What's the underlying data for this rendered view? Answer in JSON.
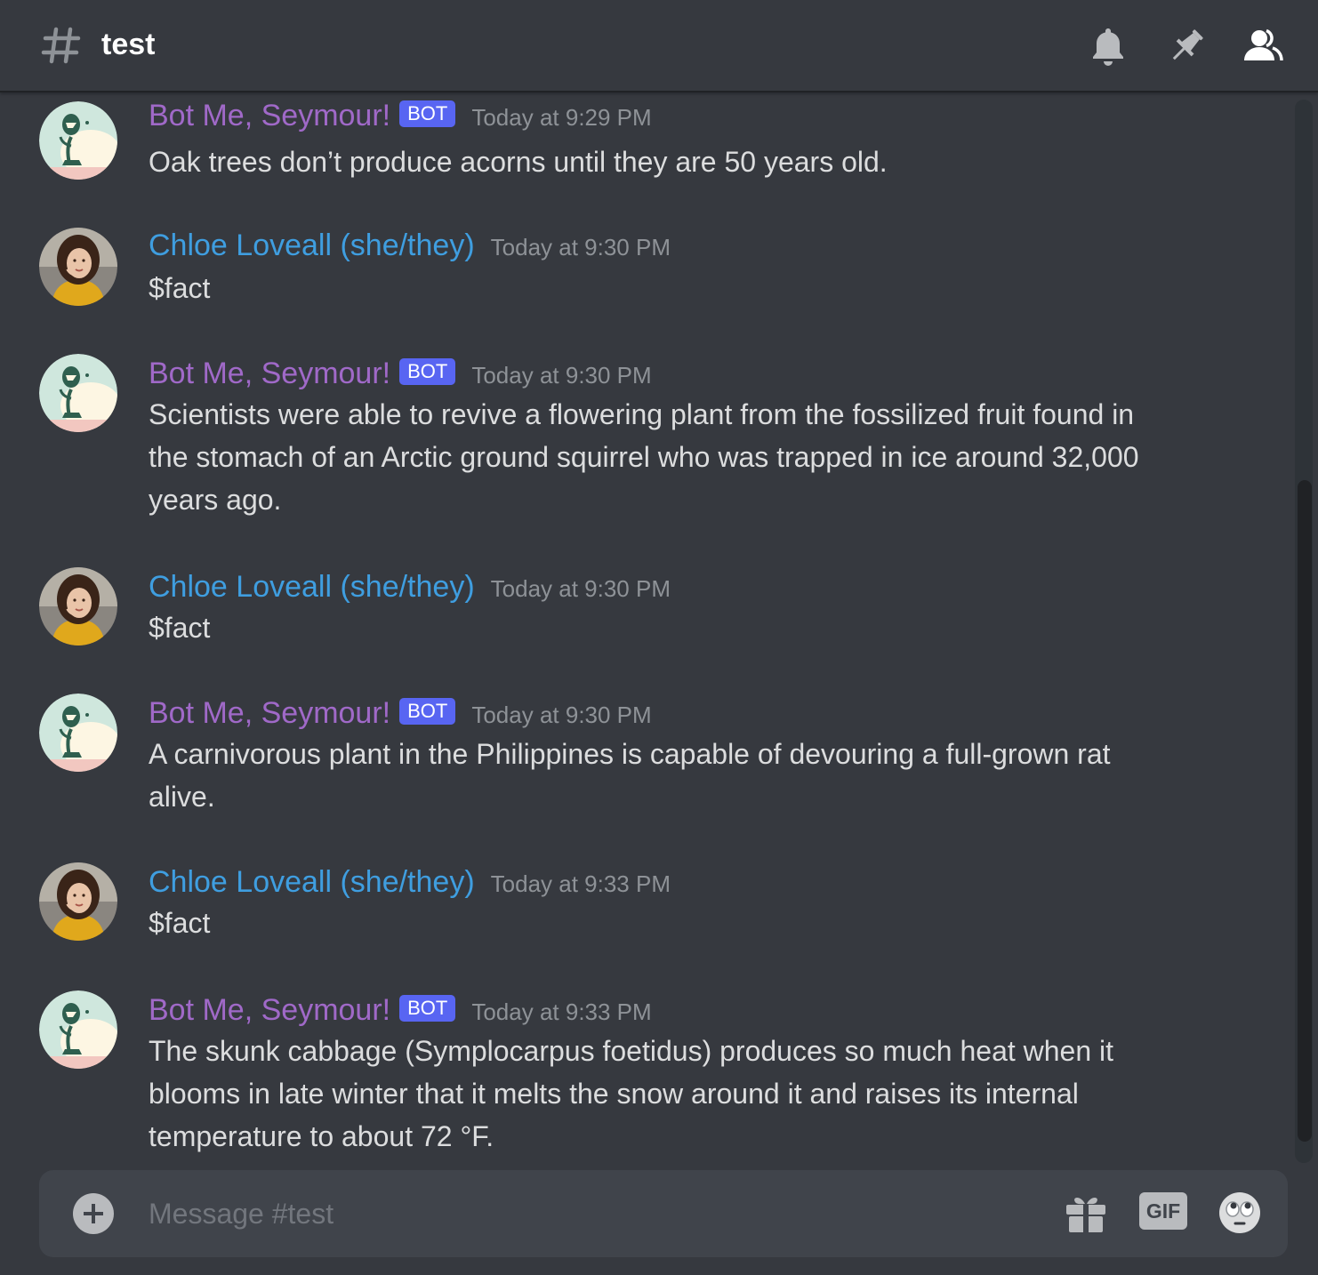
{
  "header": {
    "channel_name": "test",
    "icons": [
      "hashtag-icon",
      "bell-icon",
      "pin-icon",
      "members-icon"
    ]
  },
  "messages": [
    {
      "author": "Bot Me, Seymour!",
      "bot_tag": "BOT",
      "timestamp": "Today at 9:29 PM",
      "lines": [
        "Oak trees don’t produce acorns until they are 50 years old."
      ]
    },
    {
      "author": "Chloe Loveall (she/they)",
      "timestamp": "Today at 9:30 PM",
      "lines": [
        "$fact"
      ]
    },
    {
      "author": "Bot Me, Seymour!",
      "bot_tag": "BOT",
      "timestamp": "Today at 9:30 PM",
      "lines": [
        "Scientists were able to revive a flowering plant from the fossilized fruit found in",
        "the stomach of an Arctic ground squirrel who was trapped in ice around 32,000",
        "years ago."
      ]
    },
    {
      "author": "Chloe Loveall (she/they)",
      "timestamp": "Today at 9:30 PM",
      "lines": [
        "$fact"
      ]
    },
    {
      "author": "Bot Me, Seymour!",
      "bot_tag": "BOT",
      "timestamp": "Today at 9:30 PM",
      "lines": [
        "A carnivorous plant in the Philippines is capable of devouring a full-grown rat",
        "alive."
      ]
    },
    {
      "author": "Chloe Loveall (she/they)",
      "timestamp": "Today at 9:33 PM",
      "lines": [
        "$fact"
      ]
    },
    {
      "author": "Bot Me, Seymour!",
      "bot_tag": "BOT",
      "timestamp": "Today at 9:33 PM",
      "lines": [
        "The skunk cabbage (Symplocarpus foetidus) produces so much heat when it",
        "blooms in late winter that it melts the snow around it and raises its internal",
        "temperature to about 72 °F."
      ]
    }
  ],
  "composer": {
    "placeholder": "Message #test",
    "gif_label": "GIF",
    "icons": [
      "add-icon",
      "gift-icon",
      "emoji-icon"
    ]
  },
  "colors": {
    "background": "#36393f",
    "bot_name": "#a069c8",
    "user_name": "#3f9ee0",
    "bot_tag": "#5865f2",
    "timestamp": "#8e9297",
    "text": "#dcddde",
    "composer": "#40444b"
  }
}
